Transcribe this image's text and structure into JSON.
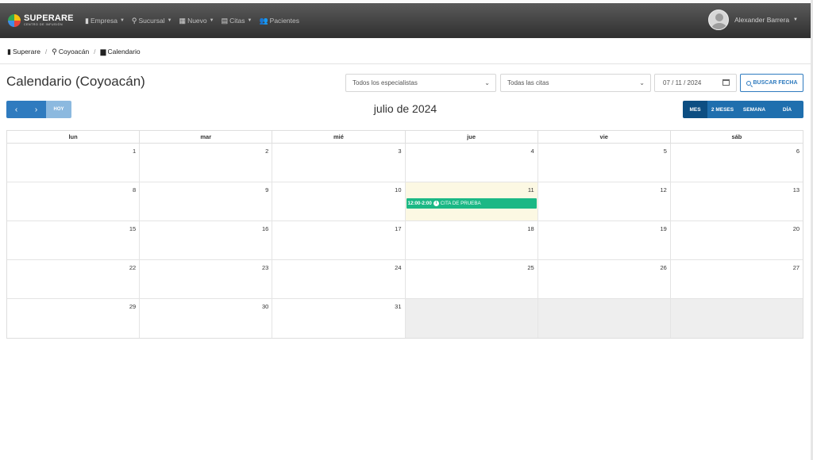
{
  "navbar": {
    "brand_name": "SUPERARE",
    "brand_sub": "CENTRO DE INFUSIÓN",
    "menu": [
      {
        "label": "Empresa",
        "icon": "building-icon",
        "has_caret": true
      },
      {
        "label": "Sucursal",
        "icon": "map-marker-icon",
        "has_caret": true
      },
      {
        "label": "Nuevo",
        "icon": "calendar-plus-icon",
        "has_caret": true
      },
      {
        "label": "Citas",
        "icon": "list-alt-icon",
        "has_caret": true
      },
      {
        "label": "Pacientes",
        "icon": "users-icon",
        "has_caret": false
      }
    ],
    "user_name": "Alexander Barrera"
  },
  "breadcrumb": {
    "items": [
      "Superare",
      "Coyoacán",
      "Calendario"
    ]
  },
  "page": {
    "title": "Calendario (Coyoacán)",
    "specialist_select": "Todos los especialistas",
    "appointments_select": "Todas las citas",
    "date_value": "07 / 11 / 2024",
    "search_button": "BUSCAR FECHA"
  },
  "toolbar": {
    "prev_symbol": "‹",
    "next_symbol": "›",
    "today_label": "HOY",
    "month_title": "julio de 2024",
    "views": [
      "MES",
      "2 MESES",
      "SEMANA",
      "DÍA"
    ]
  },
  "calendar": {
    "weekdays": [
      "lun",
      "mar",
      "mié",
      "jue",
      "vie",
      "sáb"
    ],
    "weeks": [
      [
        "1",
        "2",
        "3",
        "4",
        "5",
        "6"
      ],
      [
        "8",
        "9",
        "10",
        "11",
        "12",
        "13"
      ],
      [
        "15",
        "16",
        "17",
        "18",
        "19",
        "20"
      ],
      [
        "22",
        "23",
        "24",
        "25",
        "26",
        "27"
      ],
      [
        "29",
        "30",
        "31",
        "",
        "",
        ""
      ]
    ],
    "today_day": "11",
    "event": {
      "time": "12:00-2:00",
      "title": "CITA DE PRUEBA",
      "day": "11",
      "color": "#1bb885"
    }
  },
  "colors": {
    "primary": "#2f7bbf",
    "active_view": "#0d4e82",
    "today_bg": "#fcf8e3",
    "navbar_bg": "#3a3a3a"
  }
}
